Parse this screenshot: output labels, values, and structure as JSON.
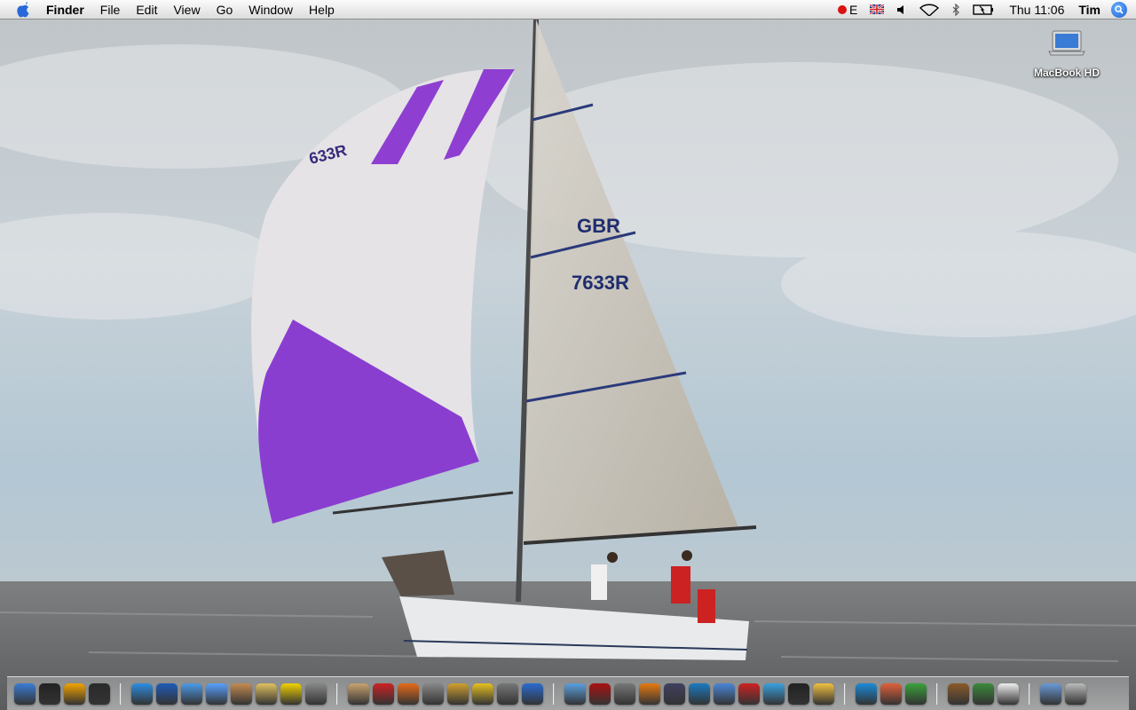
{
  "menubar": {
    "app_name": "Finder",
    "menus": [
      "File",
      "Edit",
      "View",
      "Go",
      "Window",
      "Help"
    ],
    "input_indicator": "E",
    "clock": "Thu 11:06",
    "user": "Tim"
  },
  "desktop": {
    "icons": [
      {
        "label": "MacBook HD"
      }
    ]
  },
  "wallpaper": {
    "sail_number": "7633R",
    "country": "GBR",
    "spinnaker_text": "633R"
  },
  "dock": {
    "groups": [
      [
        "finder",
        "dashboard",
        "spaces",
        "terminal"
      ],
      [
        "safari",
        "people",
        "preview",
        "ichat",
        "photo-booth",
        "notes",
        "adium",
        "script"
      ],
      [
        "address-book",
        "ical",
        "pinwheel",
        "dictionary",
        "calculator",
        "keychain",
        "disk-utility",
        "bluetooth"
      ],
      [
        "itunes",
        "photo-slideshow",
        "screenshot",
        "vlc",
        "aperture",
        "quicktime",
        "iphoto",
        "record",
        "clapboard",
        "imovie",
        "smile"
      ],
      [
        "word-art",
        "pages",
        "plant"
      ],
      [
        "game",
        "tree",
        "stormtrooper"
      ],
      [
        "applications",
        "trash"
      ]
    ],
    "colors": [
      "#3a7bd5",
      "#222222",
      "#f3a400",
      "#2a2a2a",
      "#2d8de0",
      "#1f5bb8",
      "#4c9ae8",
      "#58a0ff",
      "#c48b52",
      "#e0c060",
      "#f2d200",
      "#888888",
      "#c8a470",
      "#c22",
      "#e76a1a",
      "#888",
      "#d0a030",
      "#e6c020",
      "#777",
      "#2a6bd0",
      "#5aa0e0",
      "#aa1111",
      "#777",
      "#e67a10",
      "#404060",
      "#1a7ac0",
      "#4a86d8",
      "#c22",
      "#3aa0e0",
      "#222",
      "#f0c040",
      "#1a8ad8",
      "#e0603a",
      "#3aa23a",
      "#8a5a2a",
      "#3a8a3a",
      "#eeeeee",
      "#6a9ad8",
      "#bbbbbb"
    ]
  }
}
